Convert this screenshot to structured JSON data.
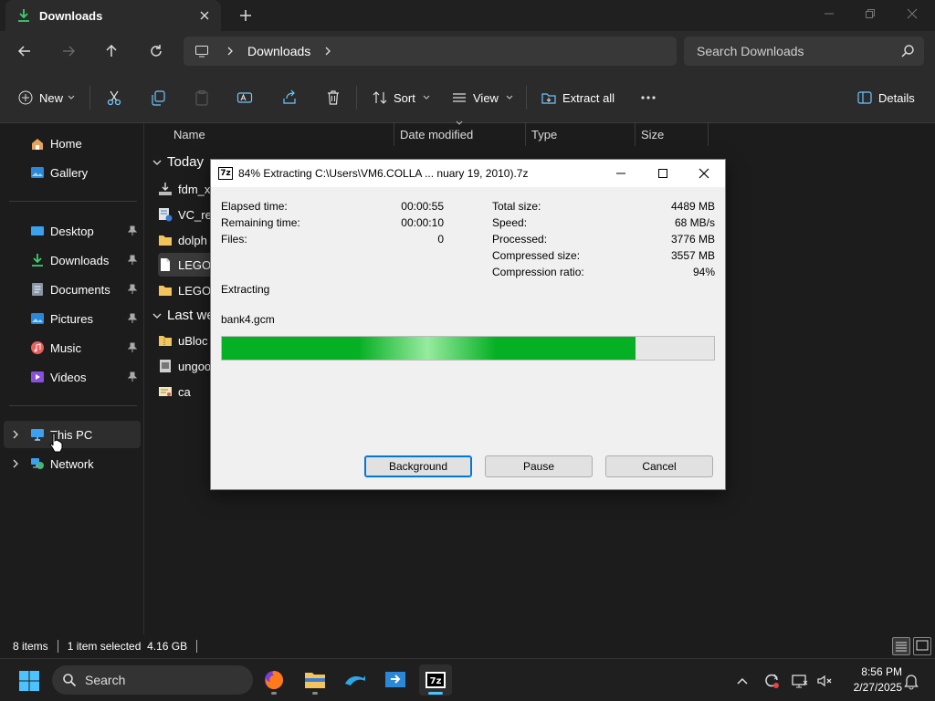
{
  "explorer": {
    "tab_title": "Downloads",
    "breadcrumb": [
      "Downloads"
    ],
    "search_placeholder": "Search Downloads",
    "commands": {
      "new": "New",
      "sort": "Sort",
      "view": "View",
      "extract_all": "Extract all",
      "details": "Details"
    },
    "sidebar": {
      "quick": [
        {
          "label": "Home",
          "icon": "home-icon"
        },
        {
          "label": "Gallery",
          "icon": "gallery-icon"
        }
      ],
      "pinned": [
        {
          "label": "Desktop",
          "icon": "desktop-icon"
        },
        {
          "label": "Downloads",
          "icon": "downloads-icon"
        },
        {
          "label": "Documents",
          "icon": "documents-icon"
        },
        {
          "label": "Pictures",
          "icon": "pictures-icon"
        },
        {
          "label": "Music",
          "icon": "music-icon"
        },
        {
          "label": "Videos",
          "icon": "videos-icon"
        }
      ],
      "locations": [
        {
          "label": "This PC",
          "icon": "this-pc-icon"
        },
        {
          "label": "Network",
          "icon": "network-icon"
        }
      ]
    },
    "columns": [
      "Name",
      "Date modified",
      "Type",
      "Size"
    ],
    "groups": {
      "today": "Today",
      "last_week": "Last we"
    },
    "files_today": [
      {
        "name": "fdm_x",
        "icon": "installer-icon"
      },
      {
        "name": "VC_re",
        "icon": "setup-icon"
      },
      {
        "name": "dolph",
        "icon": "folder-icon"
      },
      {
        "name": "LEGO",
        "icon": "file-icon"
      },
      {
        "name": "LEGO",
        "icon": "folder-icon"
      }
    ],
    "files_last_week": [
      {
        "name": "uBloc",
        "icon": "zip-folder-icon"
      },
      {
        "name": "ungoo",
        "icon": "archive-icon"
      },
      {
        "name": "ca",
        "icon": "certificate-icon"
      }
    ],
    "status": {
      "items": "8 items",
      "selection": "1 item selected  4.16 GB"
    }
  },
  "dialog": {
    "title": "84% Extracting C:\\Users\\VM6.COLLA ... nuary 19, 2010).7z",
    "app_icon_text": "7z",
    "progress_percent": 84,
    "left": [
      {
        "label": "Elapsed time:",
        "value": "00:00:55"
      },
      {
        "label": "Remaining time:",
        "value": "00:00:10"
      },
      {
        "label": "Files:",
        "value": "0"
      }
    ],
    "right": [
      {
        "label": "Total size:",
        "value": "4489 MB"
      },
      {
        "label": "Speed:",
        "value": "68 MB/s"
      },
      {
        "label": "Processed:",
        "value": "3776 MB"
      },
      {
        "label": "Compressed size:",
        "value": "3557 MB"
      },
      {
        "label": "Compression ratio:",
        "value": "94%"
      }
    ],
    "operation": "Extracting",
    "current_file": "bank4.gcm",
    "buttons": {
      "background": "Background",
      "pause": "Pause",
      "cancel": "Cancel"
    }
  },
  "taskbar": {
    "search_label": "Search",
    "apps": [
      "firefox-icon",
      "file-explorer-icon",
      "dolphin-icon",
      "remote-app-icon",
      "7zip-icon"
    ],
    "time": "8:56 PM",
    "date": "2/27/2025"
  },
  "colors": {
    "progress_green": "#06b025",
    "accent": "#4cc2ff"
  }
}
